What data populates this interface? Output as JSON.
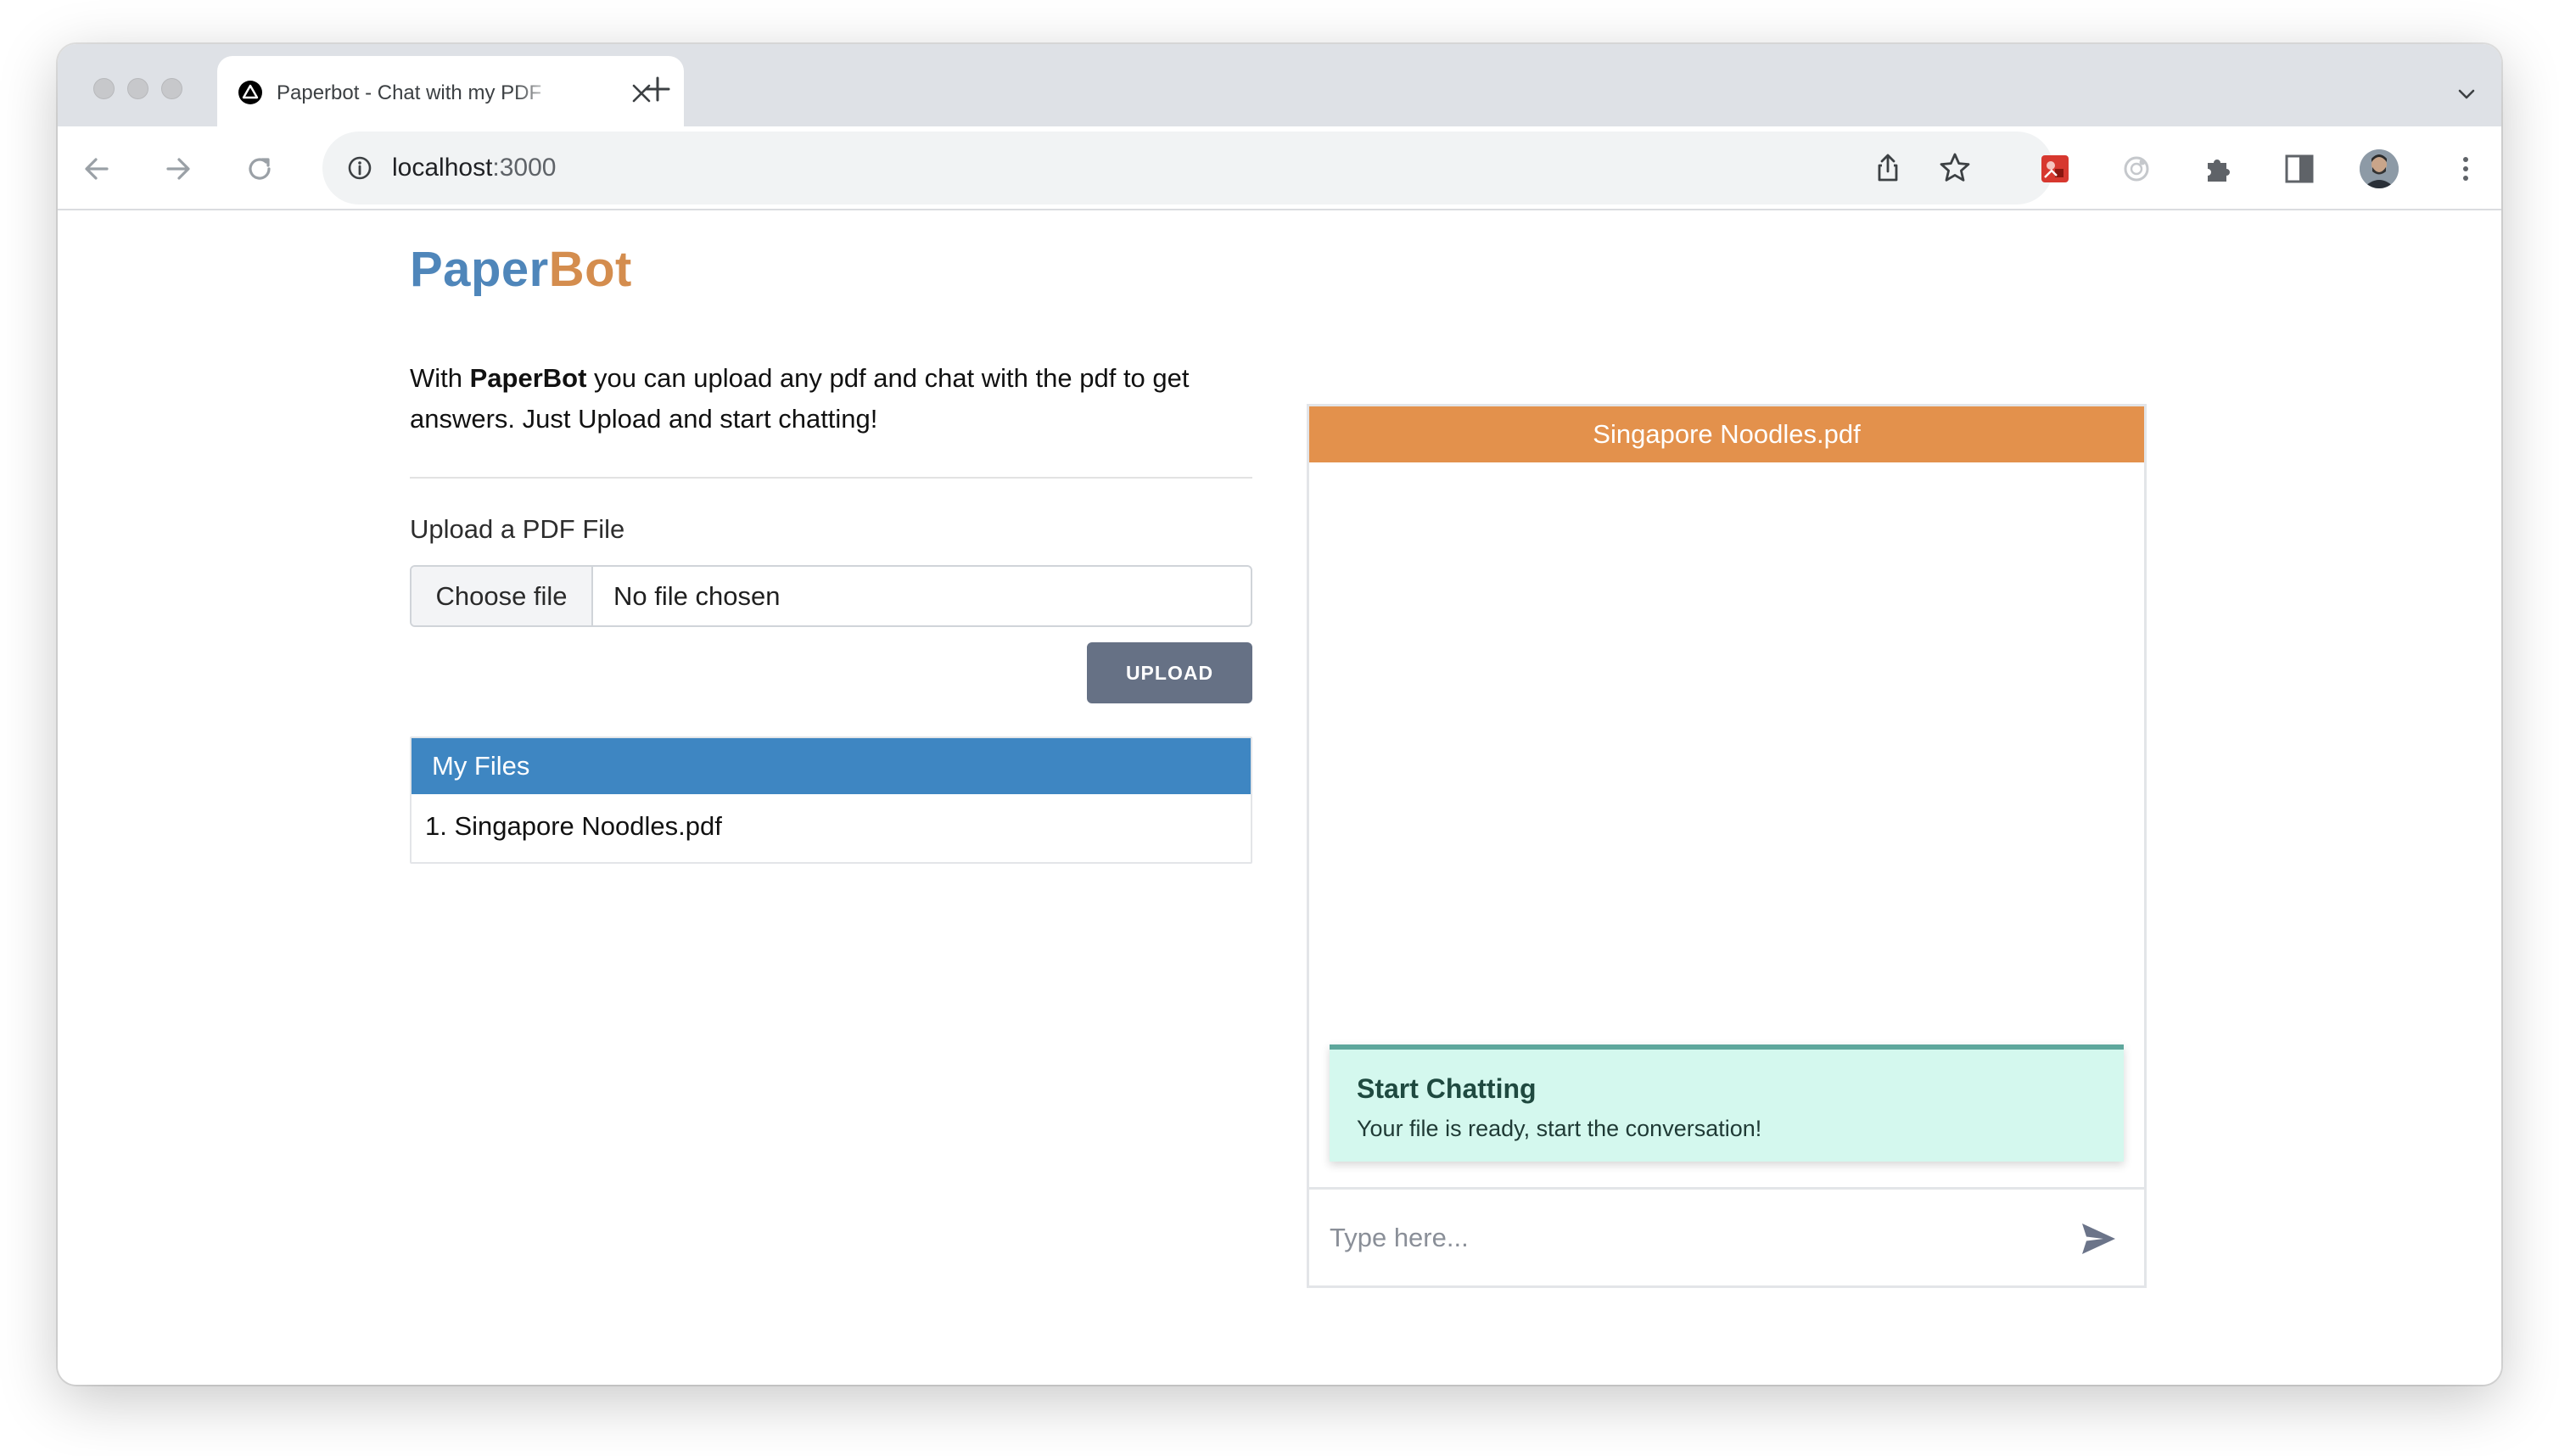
{
  "browser": {
    "tab": {
      "title": "Paperbot - Chat with my PDF",
      "favicon": "triangle-logo-icon"
    },
    "address": {
      "host": "localhost",
      "port": ":3000"
    },
    "icons": {
      "back": "arrow-left-icon",
      "forward": "arrow-right-icon",
      "reload": "reload-icon",
      "info": "info-icon",
      "share": "share-icon",
      "bookmark": "star-icon",
      "extension1": "red-extension-icon",
      "extension2": "circle-extension-icon",
      "extensions": "puzzle-icon",
      "sidepanel": "side-panel-icon",
      "profile": "avatar",
      "menu": "kebab-menu-icon"
    }
  },
  "app": {
    "logo": {
      "part1": "Paper",
      "part2": "Bot"
    },
    "intro": {
      "prefix": "With ",
      "brand": "PaperBot",
      "suffix": " you can upload any pdf and chat with the pdf to get answers. Just Upload and start chatting!"
    },
    "upload": {
      "label": "Upload a PDF File",
      "choose_label": "Choose file",
      "no_file": "No file chosen",
      "button": "UPLOAD"
    },
    "files": {
      "header": "My Files",
      "items": [
        "1. Singapore Noodles.pdf"
      ]
    },
    "chat": {
      "title": "Singapore Noodles.pdf",
      "notice_title": "Start Chatting",
      "notice_body": "Your file is ready, start the conversation!",
      "input_placeholder": "Type here...",
      "send_icon": "send-icon"
    }
  },
  "colors": {
    "logo_part1": "#4f86ba",
    "logo_part2": "#d48d4e",
    "upload_button": "#667185",
    "files_header": "#3e86c2",
    "chat_header": "#e3914c",
    "notice_bg": "#d4f8ee",
    "notice_border": "#5ea79c"
  }
}
